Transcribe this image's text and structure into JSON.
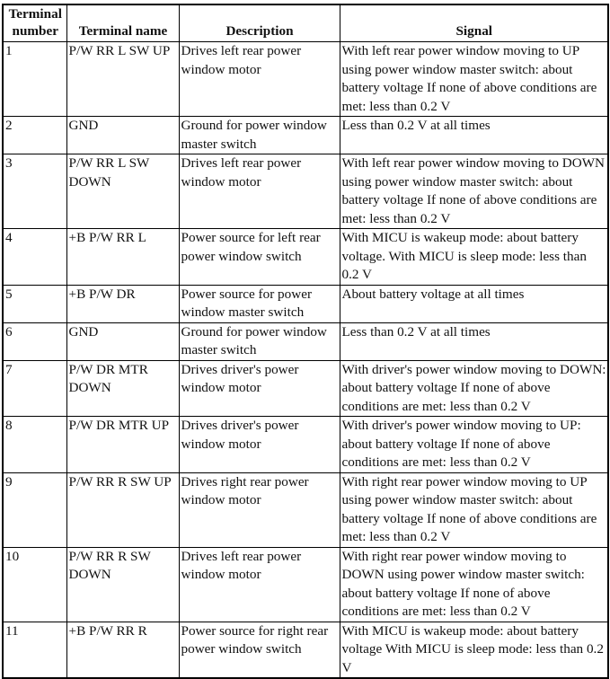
{
  "table": {
    "headers": [
      "Terminal number",
      "Terminal name",
      "Description",
      "Signal"
    ],
    "rows": [
      [
        "1",
        "P/W RR L SW UP",
        "Drives left rear power window motor",
        "With left rear power window moving to UP using power window master switch: about battery voltage If none of above conditions are met: less than 0.2 V"
      ],
      [
        "2",
        "GND",
        "Ground for power window master switch",
        "Less than 0.2 V at all times"
      ],
      [
        "3",
        "P/W RR L SW DOWN",
        "Drives left rear power window motor",
        "With left rear power window moving to DOWN using power window master switch: about battery voltage If none of above conditions are met: less than 0.2 V"
      ],
      [
        "4",
        "+B P/W RR L",
        "Power source for left rear power window switch",
        "With MICU is wakeup mode: about battery voltage. With MICU is sleep mode: less than 0.2 V"
      ],
      [
        "5",
        "+B P/W DR",
        "Power source for power window master switch",
        "About battery voltage at all times"
      ],
      [
        "6",
        "GND",
        "Ground for power window master switch",
        "Less than 0.2 V at all times"
      ],
      [
        "7",
        "P/W DR MTR DOWN",
        "Drives driver's power window motor",
        "With driver's power window moving to DOWN: about battery voltage If none of above conditions are met: less than 0.2 V"
      ],
      [
        "8",
        "P/W DR MTR UP",
        "Drives driver's power window motor",
        "With driver's power window moving to UP: about battery voltage If none of above conditions are met: less than 0.2 V"
      ],
      [
        "9",
        "P/W RR R SW UP",
        "Drives right rear power window motor",
        "With right rear power window moving to UP using power window master switch: about battery voltage If none of above conditions are met: less than 0.2 V"
      ],
      [
        "10",
        "P/W RR R SW DOWN",
        "Drives left rear power window motor",
        "With right rear power window moving to DOWN using power window master switch: about battery voltage If none of above conditions are met: less than 0.2 V"
      ],
      [
        "11",
        "+B P/W RR R",
        "Power source for right rear power window switch",
        "With MICU is wakeup mode: about battery voltage With MICU is sleep mode: less than 0.2 V"
      ]
    ]
  }
}
